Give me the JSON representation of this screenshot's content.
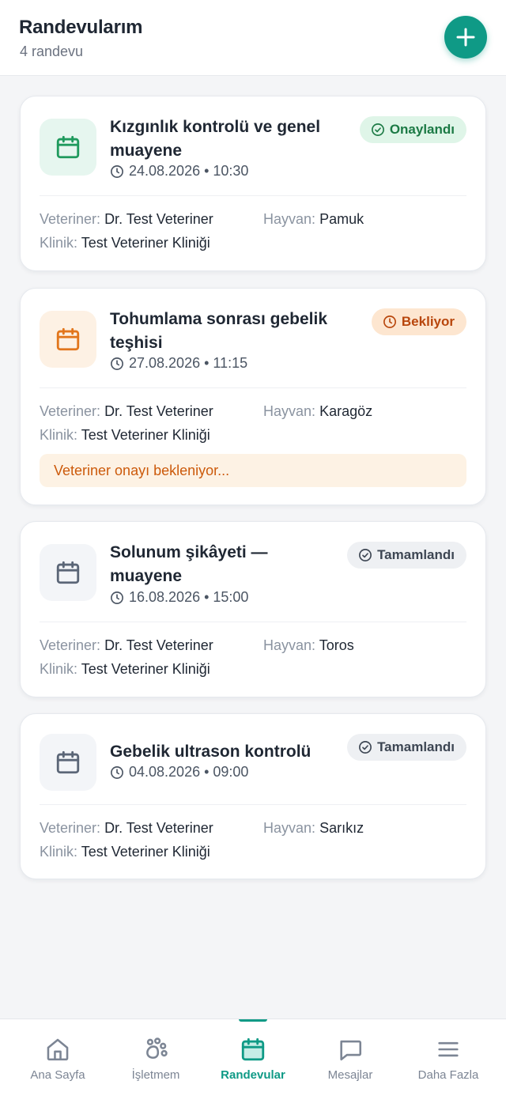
{
  "header": {
    "title": "Randevularım",
    "subtitle": "4 randevu"
  },
  "labels": {
    "vet": "Veteriner:",
    "animal": "Hayvan:",
    "clinic": "Klinik:"
  },
  "appointments": [
    {
      "title": "Kızgınlık kontrolü ve genel muayene",
      "datetime": "24.08.2026 • 10:30",
      "status": "Onaylandı",
      "status_color": "#1c7a45",
      "vet": "Dr. Test Veteriner",
      "animal": "Pamuk",
      "clinic": "Test Veteriner Kliniği"
    },
    {
      "title": "Tohumlama sonrası gebelik teşhisi",
      "datetime": "27.08.2026 • 11:15",
      "status": "Bekliyor",
      "status_color": "#b8460c",
      "vet": "Dr. Test Veteriner",
      "animal": "Karagöz",
      "clinic": "Test Veteriner Kliniği",
      "notice": "Veteriner onayı bekleniyor..."
    },
    {
      "title": "Solunum şikâyeti — muayene",
      "datetime": "16.08.2026 • 15:00",
      "status": "Tamamlandı",
      "status_color": "#3d4653",
      "vet": "Dr. Test Veteriner",
      "animal": "Toros",
      "clinic": "Test Veteriner Kliniği"
    },
    {
      "title": "Gebelik ultrason kontrolü",
      "datetime": "04.08.2026 • 09:00",
      "status": "Tamamlandı",
      "status_color": "#3d4653",
      "vet": "Dr. Test Veteriner",
      "animal": "Sarıkız",
      "clinic": "Test Veteriner Kliniği"
    }
  ],
  "tabs": [
    {
      "label": "Ana Sayfa",
      "icon": "home-icon"
    },
    {
      "label": "İşletmem",
      "icon": "paw-icon"
    },
    {
      "label": "Randevular",
      "icon": "calendar-icon",
      "active": true
    },
    {
      "label": "Mesajlar",
      "icon": "message-icon"
    },
    {
      "label": "Daha Fazla",
      "icon": "menu-icon"
    }
  ],
  "colors": {
    "accent": "#0f9a86",
    "pending": "#e2761c",
    "approved": "#1f9a5d",
    "neutral": "#5b6677"
  }
}
